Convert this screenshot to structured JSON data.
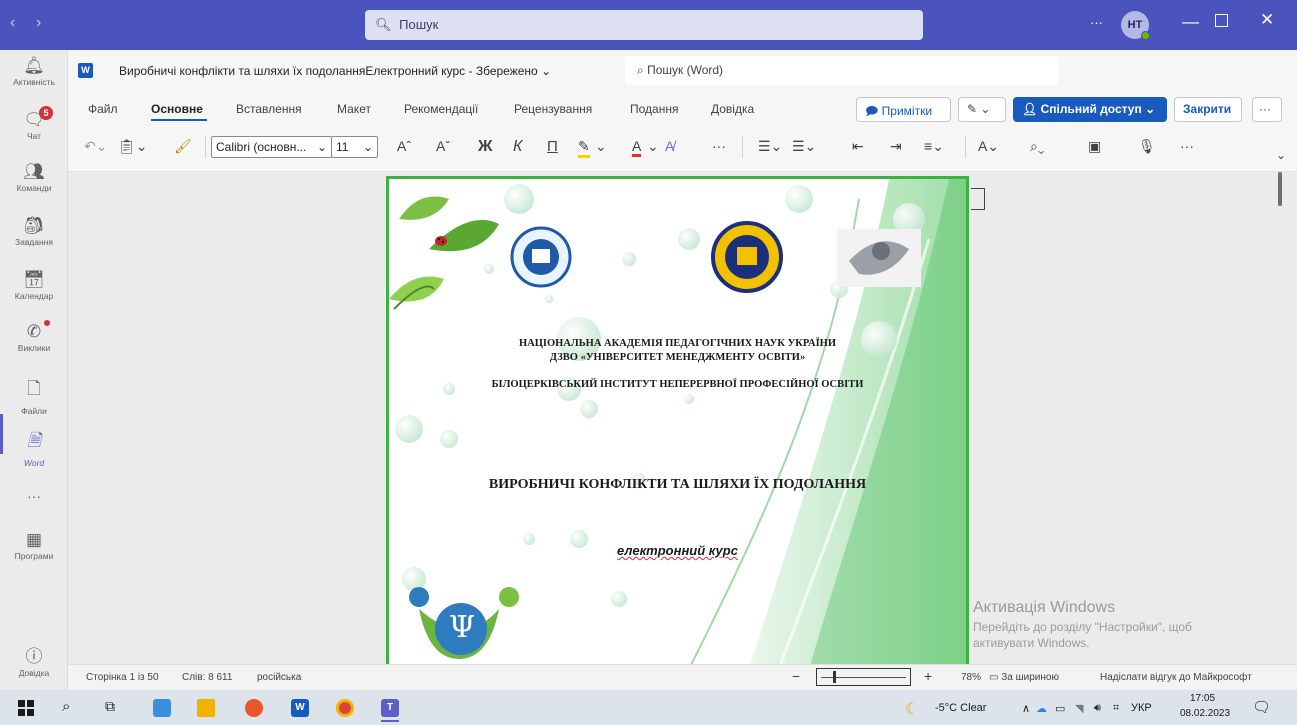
{
  "teams": {
    "search_placeholder": "Пошук",
    "more": "···",
    "avatar_initials": "НТ",
    "rail": [
      {
        "label": "Активність",
        "icon": "bell-icon"
      },
      {
        "label": "Чат",
        "icon": "chat-icon",
        "badge": "5"
      },
      {
        "label": "Команди",
        "icon": "teams-icon"
      },
      {
        "label": "Завдання",
        "icon": "assignments-icon"
      },
      {
        "label": "Календар",
        "icon": "calendar-icon"
      },
      {
        "label": "Виклики",
        "icon": "phone-icon"
      },
      {
        "label": "Файли",
        "icon": "file-icon"
      },
      {
        "label": "Word",
        "icon": "word-icon"
      },
      {
        "label": "···",
        "icon": "more-icon"
      },
      {
        "label": "Програми",
        "icon": "apps-icon"
      },
      {
        "label": "Довідка",
        "icon": "help-icon"
      }
    ]
  },
  "word": {
    "doc_title": "Виробничі конфлікти та шляхи їх подоланняЕлектронний курс  -  Збережено",
    "search_placeholder": "Пошук (Word)",
    "tabs": [
      "Файл",
      "Основне",
      "Вставлення",
      "Макет",
      "Рекомендації",
      "Рецензування",
      "Подання",
      "Довідка"
    ],
    "comments_label": "Примітки",
    "share_label": "Спільний доступ",
    "close_label": "Закрити",
    "font_name": "Calibri (основн...",
    "font_size": "11",
    "bold_glyph": "Ж",
    "italic_glyph": "К",
    "underline_glyph": "П"
  },
  "document": {
    "line1": "НАЦІОНАЛЬНА АКАДЕМІЯ ПЕДАГОГІЧНИХ НАУК УКРАЇНИ",
    "line2": "ДЗВО «УНІВЕРСИТЕТ МЕНЕДЖМЕНТУ ОСВІТИ»",
    "line3": "БІЛОЦЕРКІВСЬКИЙ ІНСТИТУТ НЕПЕРЕРВНОЇ ПРОФЕСІЙНОЇ ОСВІТИ",
    "title": "ВИРОБНИЧІ КОНФЛІКТИ ТА ШЛЯХИ ЇХ ПОДОЛАННЯ",
    "subtitle": "електронний курс",
    "logo_letter": "Ψ"
  },
  "activation": {
    "title": "Активація Windows",
    "line1": "Перейдіть до розділу \"Настройки\", щоб",
    "line2": "активувати Windows."
  },
  "status": {
    "page": "Сторінка 1 із 50",
    "words": "Слів: 8 611",
    "language": "російська",
    "zoom_minus": "−",
    "zoom_plus": "+",
    "zoom": "78%",
    "fit_width": "За шириною",
    "feedback": "Надіслати відгук до Майкрософт"
  },
  "taskbar": {
    "weather": "-5°C  Clear",
    "lang": "УКР",
    "time": "17:05",
    "date": "08.02.2023"
  }
}
